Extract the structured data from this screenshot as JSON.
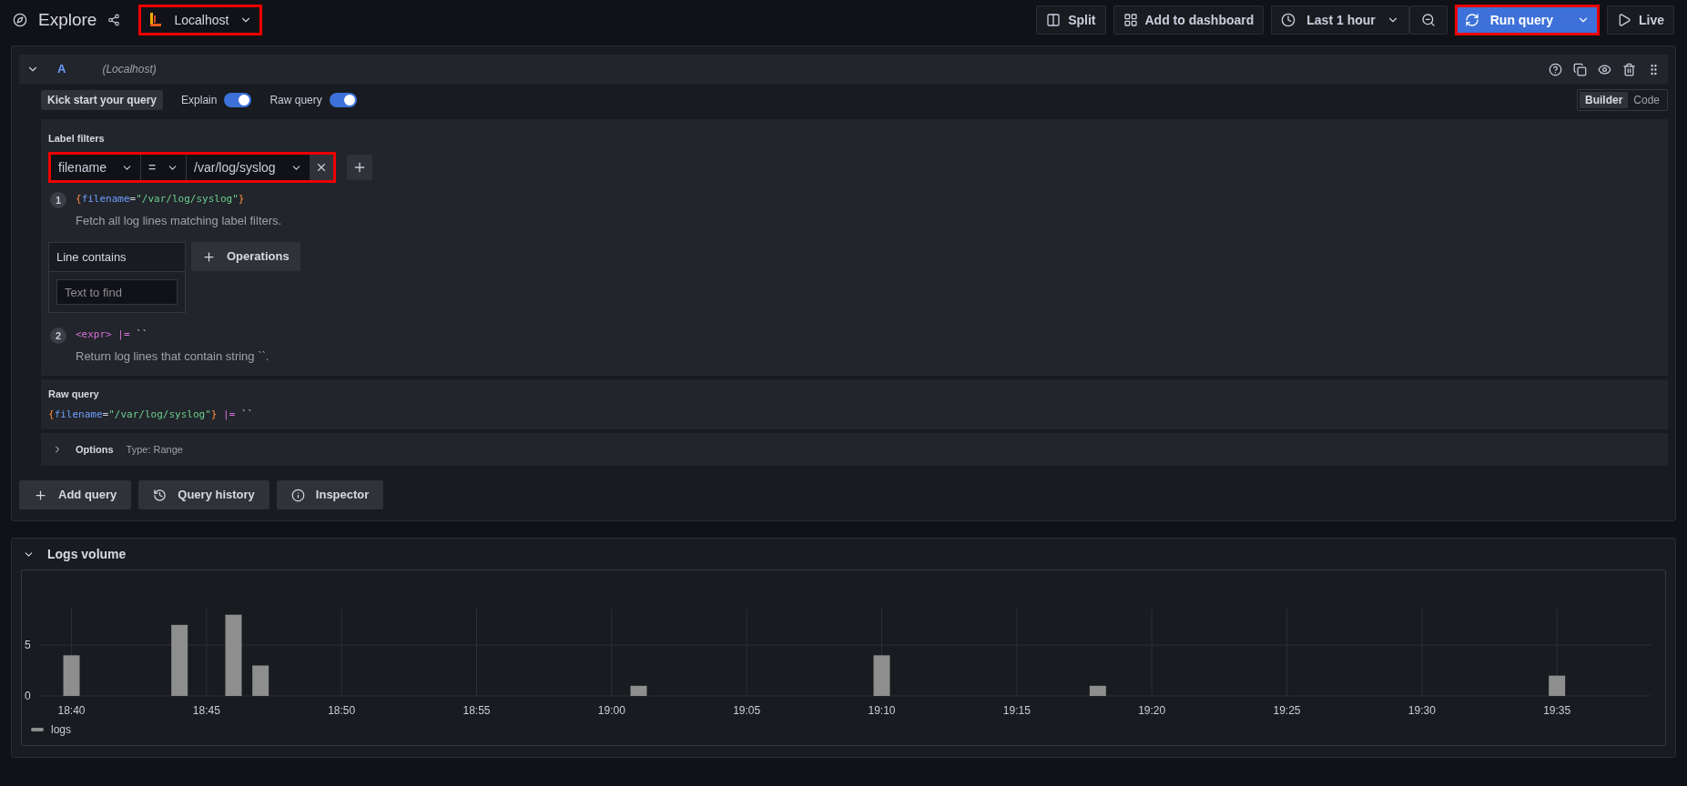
{
  "header": {
    "title": "Explore",
    "datasource": {
      "name": "Localhost",
      "highlighted": true
    }
  },
  "toolbar": {
    "split": "Split",
    "add_to_dashboard": "Add to dashboard",
    "time_range": "Last 1 hour",
    "run_query": {
      "label": "Run query",
      "highlighted": true
    },
    "live": "Live"
  },
  "query": {
    "letter": "A",
    "datasource": "(Localhost)",
    "expanded": true,
    "kick_start_button": "Kick start your query",
    "toggles": [
      {
        "label": "Explain",
        "on": true
      },
      {
        "label": "Raw query",
        "on": true
      }
    ],
    "modes": [
      {
        "label": "Builder",
        "selected": true
      },
      {
        "label": "Code",
        "selected": false
      }
    ],
    "label_filters": {
      "title": "Label filters",
      "highlighted": true,
      "label": "filename",
      "operator": "=",
      "value": "/var/log/syslog"
    },
    "steps": [
      {
        "number": "1",
        "code": [
          {
            "kind": "brace",
            "text": "{"
          },
          {
            "kind": "key",
            "text": "filename"
          },
          {
            "kind": "op",
            "text": "="
          },
          {
            "kind": "string",
            "text": "\"/var/log/syslog\""
          },
          {
            "kind": "brace",
            "text": "}"
          }
        ],
        "description": "Fetch all log lines matching label filters."
      },
      {
        "number": "2",
        "code": [
          {
            "kind": "expr",
            "text": "<expr>"
          },
          {
            "kind": "pipe",
            "text": "|="
          },
          {
            "kind": "op",
            "text": "``"
          }
        ],
        "description": "Return log lines that contain string ``."
      }
    ],
    "line_contains": {
      "title": "Line contains",
      "placeholder": "Text to find"
    },
    "operations_button": "Operations",
    "raw_query": {
      "title": "Raw query",
      "code": [
        {
          "kind": "brace",
          "text": "{"
        },
        {
          "kind": "key",
          "text": "filename"
        },
        {
          "kind": "op",
          "text": "="
        },
        {
          "kind": "string",
          "text": "\"/var/log/syslog\""
        },
        {
          "kind": "brace",
          "text": "}"
        },
        {
          "kind": "pipe",
          "text": "|="
        },
        {
          "kind": "op",
          "text": "``"
        }
      ]
    },
    "options": {
      "title": "Options",
      "summary": "Type: Range",
      "expanded": false
    }
  },
  "actions": [
    {
      "kind": "add",
      "label": "Add query"
    },
    {
      "kind": "history",
      "label": "Query history"
    },
    {
      "kind": "info",
      "label": "Inspector"
    }
  ],
  "logs_volume": {
    "title": "Logs volume",
    "expanded": true,
    "chart_data": {
      "type": "bar",
      "grid": true,
      "categories": [
        null,
        "18:40",
        null,
        null,
        null,
        null,
        "18:45",
        null,
        null,
        null,
        null,
        "18:50",
        null,
        null,
        null,
        null,
        "18:55",
        null,
        null,
        null,
        null,
        "19:00",
        null,
        null,
        null,
        null,
        "19:05",
        null,
        null,
        null,
        null,
        "19:10",
        null,
        null,
        null,
        null,
        "19:15",
        null,
        null,
        null,
        null,
        "19:20",
        null,
        null,
        null,
        null,
        "19:25",
        null,
        null,
        null,
        null,
        "19:30",
        null,
        null,
        null,
        null,
        "19:35",
        null,
        null,
        null
      ],
      "series": [
        {
          "name": "logs",
          "color": "#8e8e8e",
          "values": [
            0,
            4,
            0,
            0,
            0,
            7,
            0,
            8,
            3,
            0,
            0,
            0,
            0,
            0,
            0,
            0,
            0,
            0,
            0,
            0,
            0,
            0,
            1,
            0,
            0,
            0,
            0,
            0,
            0,
            0,
            0,
            4,
            0,
            0,
            0,
            0,
            0,
            0,
            0,
            1,
            0,
            0,
            0,
            0,
            0,
            0,
            0,
            0,
            0,
            0,
            0,
            0,
            0,
            0,
            0,
            0,
            2,
            0,
            0,
            0
          ]
        }
      ],
      "ylim": [
        0,
        8.6
      ],
      "yticks": [
        {
          "value": 0,
          "label": "0"
        },
        {
          "value": 5,
          "label": "5"
        }
      ]
    }
  }
}
